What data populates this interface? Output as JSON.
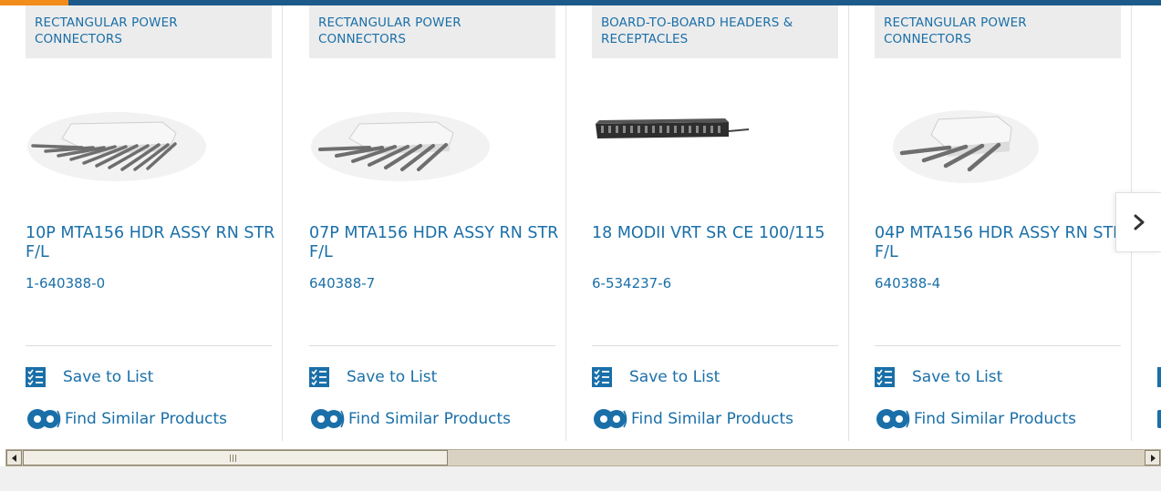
{
  "brand": {
    "accent": "#f28c1a",
    "primary": "#1c5a8a",
    "link": "#1a6fa8"
  },
  "cards": [
    {
      "category": "RECTANGULAR POWER CONNECTORS",
      "name": "10P MTA156 HDR ASSY RN STR F/L",
      "part_number": "1-640388-0",
      "save_label": "Save to List",
      "similar_label": "Find Similar Products"
    },
    {
      "category": "RECTANGULAR POWER CONNECTORS",
      "name": "07P MTA156 HDR ASSY RN STR F/L",
      "part_number": "640388-7",
      "save_label": "Save to List",
      "similar_label": "Find Similar Products"
    },
    {
      "category": "BOARD-TO-BOARD HEADERS & RECEPTACLES",
      "name": "18 MODII VRT SR CE 100/115",
      "part_number": "6-534237-6",
      "save_label": "Save to List",
      "similar_label": "Find Similar Products"
    },
    {
      "category": "RECTANGULAR POWER CONNECTORS",
      "name": "04P MTA156 HDR ASSY RN STR F/L",
      "part_number": "640388-4",
      "save_label": "Save to List",
      "similar_label": "Find Similar Products"
    }
  ],
  "next_icon": "chevron-right-icon",
  "scrollbar_icons": {
    "left": "arrow-left-icon",
    "right": "arrow-right-icon"
  }
}
